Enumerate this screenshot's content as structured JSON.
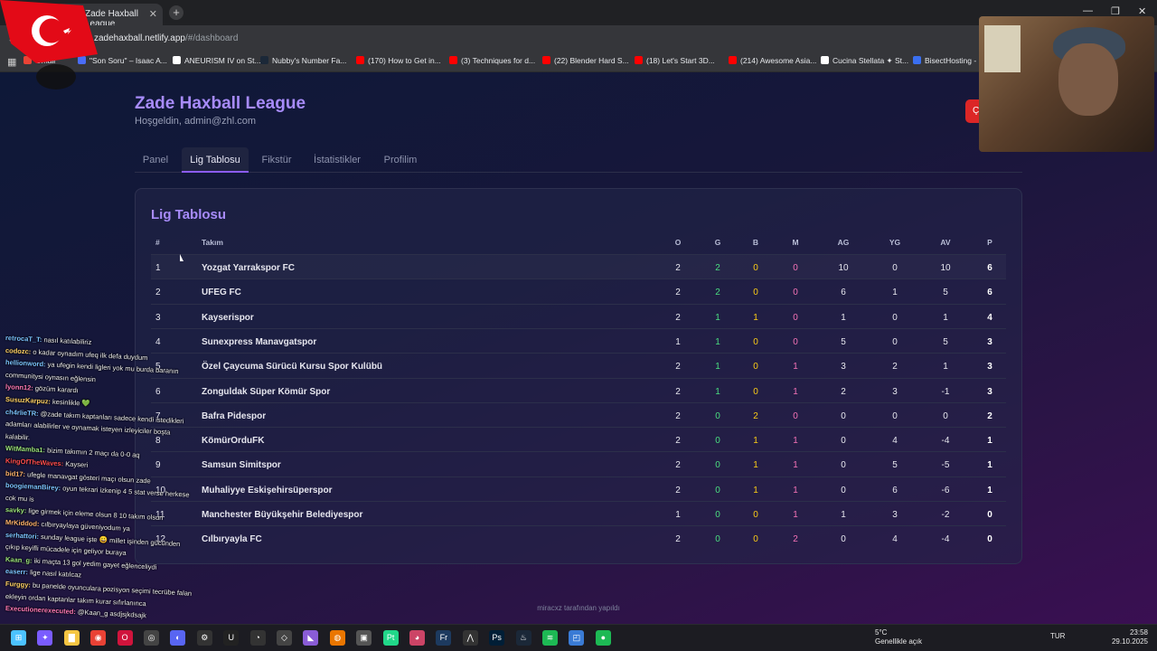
{
  "browser": {
    "tab_title": "Zade Haxball League",
    "new_tab": "+",
    "close": "✕",
    "url_host": "zadehaxball.netlify.app",
    "url_path": "/#/dashboard",
    "window_controls": [
      "—",
      "❐",
      "✕"
    ],
    "bookmarks": [
      {
        "label": "Gmail",
        "color": "#ea4335"
      },
      {
        "label": "\"Son Soru\" – Isaac A...",
        "color": "#4a6cf7"
      },
      {
        "label": "ANEURISM IV on St...",
        "color": "#ffffff"
      },
      {
        "label": "Nubby's Number Fa...",
        "color": "#1b2838"
      },
      {
        "label": "(170) How to Get in...",
        "color": "#ff0000"
      },
      {
        "label": "(3) Techniques for d...",
        "color": "#ff0000"
      },
      {
        "label": "(22) Blender Hard S...",
        "color": "#ff0000"
      },
      {
        "label": "(18) Let's Start 3D...",
        "color": "#ff0000"
      },
      {
        "label": "(214) Awesome Asia...",
        "color": "#ff0000"
      },
      {
        "label": "Cucina Stellata ✦ St...",
        "color": "#ffffff"
      },
      {
        "label": "BisectHosting - D...",
        "color": "#3a6ff0"
      }
    ]
  },
  "app": {
    "title": "Zade Haxball League",
    "welcome": "Hoşgeldin, admin@zhl.com",
    "logout_fragment": "Ç",
    "nav_tabs": [
      "Panel",
      "Lig Tablosu",
      "Fikstür",
      "İstatistikler",
      "Profilim"
    ],
    "active_tab": "Lig Tablosu",
    "footer": "miracxz tarafından yapıldı"
  },
  "standings": {
    "title": "Lig Tablosu",
    "headers": [
      "#",
      "Takım",
      "O",
      "G",
      "B",
      "M",
      "AG",
      "YG",
      "AV",
      "P"
    ],
    "rows": [
      {
        "pos": "1",
        "team": "Yozgat Yarrakspor FC",
        "o": "2",
        "g": "2",
        "b": "0",
        "m": "0",
        "ag": "10",
        "yg": "0",
        "av": "10",
        "p": "6"
      },
      {
        "pos": "2",
        "team": "UFEG FC",
        "o": "2",
        "g": "2",
        "b": "0",
        "m": "0",
        "ag": "6",
        "yg": "1",
        "av": "5",
        "p": "6"
      },
      {
        "pos": "3",
        "team": "Kayserispor",
        "o": "2",
        "g": "1",
        "b": "1",
        "m": "0",
        "ag": "1",
        "yg": "0",
        "av": "1",
        "p": "4"
      },
      {
        "pos": "4",
        "team": "Sunexpress Manavgatspor",
        "o": "1",
        "g": "1",
        "b": "0",
        "m": "0",
        "ag": "5",
        "yg": "0",
        "av": "5",
        "p": "3"
      },
      {
        "pos": "5",
        "team": "Özel Çaycuma Sürücü Kursu Spor Kulübü",
        "o": "2",
        "g": "1",
        "b": "0",
        "m": "1",
        "ag": "3",
        "yg": "2",
        "av": "1",
        "p": "3"
      },
      {
        "pos": "6",
        "team": "Zonguldak Süper Kömür Spor",
        "o": "2",
        "g": "1",
        "b": "0",
        "m": "1",
        "ag": "2",
        "yg": "3",
        "av": "-1",
        "p": "3"
      },
      {
        "pos": "7",
        "team": "Bafra Pidespor",
        "o": "2",
        "g": "0",
        "b": "2",
        "m": "0",
        "ag": "0",
        "yg": "0",
        "av": "0",
        "p": "2"
      },
      {
        "pos": "8",
        "team": "KömürOrduFK",
        "o": "2",
        "g": "0",
        "b": "1",
        "m": "1",
        "ag": "0",
        "yg": "4",
        "av": "-4",
        "p": "1"
      },
      {
        "pos": "9",
        "team": "Samsun Simitspor",
        "o": "2",
        "g": "0",
        "b": "1",
        "m": "1",
        "ag": "0",
        "yg": "5",
        "av": "-5",
        "p": "1"
      },
      {
        "pos": "10",
        "team": "Muhaliyye Eskişehirsüperspor",
        "o": "2",
        "g": "0",
        "b": "1",
        "m": "1",
        "ag": "0",
        "yg": "6",
        "av": "-6",
        "p": "1"
      },
      {
        "pos": "11",
        "team": "Manchester Büyükşehir Belediyespor",
        "o": "1",
        "g": "0",
        "b": "0",
        "m": "1",
        "ag": "1",
        "yg": "3",
        "av": "-2",
        "p": "0"
      },
      {
        "pos": "12",
        "team": "Cılbıryayla FC",
        "o": "2",
        "g": "0",
        "b": "0",
        "m": "2",
        "ag": "0",
        "yg": "4",
        "av": "-4",
        "p": "0"
      }
    ],
    "colors": {
      "win": "#4ade80",
      "draw": "#facc15",
      "loss": "#f472b6"
    }
  },
  "chat": [
    {
      "user": "retrocaT_T:",
      "color": "#7cc4ff",
      "msg": "nasıl katılabiliriz"
    },
    {
      "user": "codozc:",
      "color": "#ffd166",
      "msg": "o kadar oynadım ufeq ilk defa duydum"
    },
    {
      "user": "hellionword:",
      "color": "#7cc4ff",
      "msg": "ya ufegin kendi ligleri yok mu burda baranın"
    },
    {
      "user": "",
      "color": "#ffffff",
      "msg": "communitysi oynasın eğlensin"
    },
    {
      "user": "lyonn12:",
      "color": "#ff7ab6",
      "msg": "gözüm karardı"
    },
    {
      "user": "SusuzKarpuz:",
      "color": "#ffd166",
      "msg": "kesinlikle 💚"
    },
    {
      "user": "ch4rlieTR:",
      "color": "#7cc4ff",
      "msg": "@zade takım kaptanları sadece kendi istedikleri"
    },
    {
      "user": "",
      "color": "#ffffff",
      "msg": "adamları alabilirler ve oynamak isteyen izleyiciler boşta"
    },
    {
      "user": "",
      "color": "#ffffff",
      "msg": "kalabilir."
    },
    {
      "user": "WitMamba1:",
      "color": "#9be37a",
      "msg": "bizim takımın 2 maçı da 0-0 aq"
    },
    {
      "user": "KingOfTheWaves:",
      "color": "#ff4d4d",
      "msg": "Kayseri"
    },
    {
      "user": "bid17:",
      "color": "#ffb36b",
      "msg": "ufegle manavgat gösteri maçı olsun zade"
    },
    {
      "user": "boogiemanBirey:",
      "color": "#7cc4ff",
      "msg": "oyun tekrari izkenip 4 5 stat verse herkese"
    },
    {
      "user": "",
      "color": "#ffffff",
      "msg": "cok mu is"
    },
    {
      "user": "savky:",
      "color": "#9be37a",
      "msg": "lige girmek için eleme olsun 8 10 takım olsun"
    },
    {
      "user": "MrKiddod:",
      "color": "#ffb36b",
      "msg": "cılbıryaylaya güveniyodum ya"
    },
    {
      "user": "serhattori:",
      "color": "#7cc4ff",
      "msg": "sunday league işte 😀 millet işinden gücünden"
    },
    {
      "user": "",
      "color": "#ffffff",
      "msg": "çıkıp keyifli mücadele için geliyor buraya"
    },
    {
      "user": "Kaan_g:",
      "color": "#9be37a",
      "msg": "iki maçta 13 gol yedim gayet eğlenceliydi"
    },
    {
      "user": "easerr:",
      "color": "#7cc4ff",
      "msg": "lige nasıl katılcaz"
    },
    {
      "user": "Furggy:",
      "color": "#ffd166",
      "msg": "bu panelde oyunculara pozisyon seçimi tecrübe falan"
    },
    {
      "user": "",
      "color": "#ffffff",
      "msg": "ekleyin ordan kaptanlar takım kurar sıfırlanınca"
    },
    {
      "user": "Executionerexecuted:",
      "color": "#ff7ab6",
      "msg": "@Kaan_g asdjsjkdsajk"
    }
  ],
  "taskbar": {
    "weather_temp": "5°C",
    "weather_desc": "Genellikle açık",
    "lang": "TUR",
    "time": "23:58",
    "date": "29.10.2025",
    "apps": [
      {
        "name": "windows-start-icon",
        "color": "#4cc2ff",
        "glyph": "⊞"
      },
      {
        "name": "copilot-icon",
        "color": "#7a5cff",
        "glyph": "✦"
      },
      {
        "name": "file-explorer-icon",
        "color": "#f5c542",
        "glyph": "▇"
      },
      {
        "name": "chrome-icon",
        "color": "#e94235",
        "glyph": "◉"
      },
      {
        "name": "opera-icon",
        "color": "#d0143c",
        "glyph": "O"
      },
      {
        "name": "obs-icon",
        "color": "#444444",
        "glyph": "◎"
      },
      {
        "name": "discord-icon",
        "color": "#5865f2",
        "glyph": "◐"
      },
      {
        "name": "app-icon",
        "color": "#333333",
        "glyph": "⚙"
      },
      {
        "name": "unreal-icon",
        "color": "#222222",
        "glyph": "U"
      },
      {
        "name": "github-icon",
        "color": "#333333",
        "glyph": "◔"
      },
      {
        "name": "unity-icon",
        "color": "#444444",
        "glyph": "◇"
      },
      {
        "name": "visual-studio-icon",
        "color": "#8a5cd6",
        "glyph": "◣"
      },
      {
        "name": "blender-icon",
        "color": "#ea7600",
        "glyph": "◍"
      },
      {
        "name": "roblox-icon",
        "color": "#555555",
        "glyph": "▣"
      },
      {
        "name": "pycharm-icon",
        "color": "#21d789",
        "glyph": "Pt"
      },
      {
        "name": "davinci-icon",
        "color": "#cc4466",
        "glyph": "◕"
      },
      {
        "name": "fresco-icon",
        "color": "#1d3a5f",
        "glyph": "Fr"
      },
      {
        "name": "inkscape-icon",
        "color": "#333333",
        "glyph": "⋀"
      },
      {
        "name": "photoshop-icon",
        "color": "#001e36",
        "glyph": "Ps"
      },
      {
        "name": "steam-icon",
        "color": "#1b2838",
        "glyph": "♨"
      },
      {
        "name": "spotify-icon",
        "color": "#1db954",
        "glyph": "≋"
      },
      {
        "name": "app2-icon",
        "color": "#3a7bd5",
        "glyph": "◰"
      },
      {
        "name": "spotify2-icon",
        "color": "#1db954",
        "glyph": "●"
      }
    ]
  }
}
